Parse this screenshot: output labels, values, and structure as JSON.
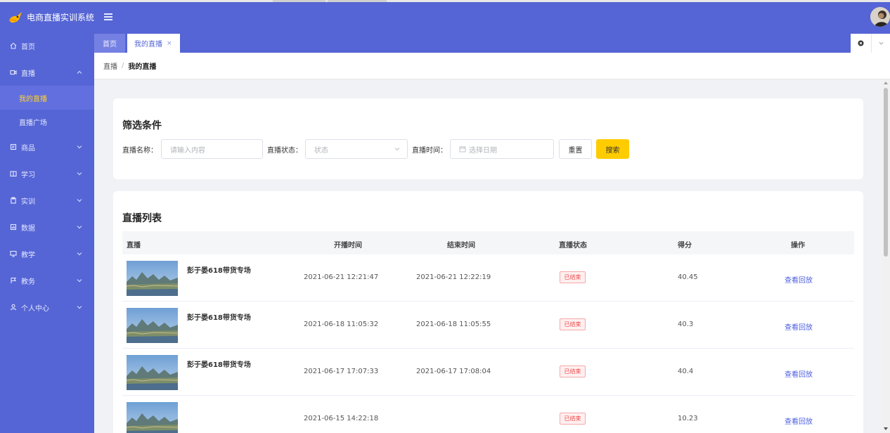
{
  "app": {
    "title": "电商直播实训系统"
  },
  "sidebar": {
    "items": [
      {
        "label": "首页",
        "icon": "home-icon",
        "has_children": false
      },
      {
        "label": "直播",
        "icon": "video-camera-icon",
        "has_children": true,
        "expanded": true,
        "children": [
          {
            "label": "我的直播",
            "active": true
          },
          {
            "label": "直播广场",
            "active": false
          }
        ]
      },
      {
        "label": "商品",
        "icon": "goods-icon",
        "has_children": true,
        "expanded": false
      },
      {
        "label": "学习",
        "icon": "book-icon",
        "has_children": true,
        "expanded": false
      },
      {
        "label": "实训",
        "icon": "clipboard-icon",
        "has_children": true,
        "expanded": false
      },
      {
        "label": "数据",
        "icon": "data-chart-icon",
        "has_children": true,
        "expanded": false
      },
      {
        "label": "教学",
        "icon": "monitor-icon",
        "has_children": true,
        "expanded": false
      },
      {
        "label": "教务",
        "icon": "flag-icon",
        "has_children": true,
        "expanded": false
      },
      {
        "label": "个人中心",
        "icon": "user-icon",
        "has_children": true,
        "expanded": false
      }
    ]
  },
  "tabs": {
    "home": "首页",
    "current": "我的直播",
    "close": "×"
  },
  "breadcrumb": {
    "parent": "直播",
    "separator": "/",
    "current": "我的直播"
  },
  "filter": {
    "title": "筛选条件",
    "name_label": "直播名称：",
    "name_placeholder": "请输入内容",
    "status_label": "直播状态：",
    "status_placeholder": "状态",
    "time_label": "直播时间：",
    "time_placeholder": "选择日期",
    "reset_label": "重置",
    "search_label": "搜索"
  },
  "list": {
    "title": "直播列表",
    "columns": {
      "live": "直播",
      "start": "开播时间",
      "end": "结束时间",
      "status": "直播状态",
      "score": "得分",
      "action": "操作"
    },
    "rows": [
      {
        "name": "彭于晏618带货专场",
        "start": "2021-06-21 12:21:47",
        "end": "2021-06-21 12:22:19",
        "status": "已结束",
        "score": "40.45",
        "action": "查看回放"
      },
      {
        "name": "彭于晏618带货专场",
        "start": "2021-06-18 11:05:32",
        "end": "2021-06-18 11:05:55",
        "status": "已结束",
        "score": "40.3",
        "action": "查看回放"
      },
      {
        "name": "彭于晏618带货专场",
        "start": "2021-06-17 17:07:33",
        "end": "2021-06-17 17:08:04",
        "status": "已结束",
        "score": "40.4",
        "action": "查看回放"
      },
      {
        "name": "",
        "start": "2021-06-15 14:22:18",
        "end": "",
        "status": "已结束",
        "score": "10.23",
        "action": "查看回放"
      }
    ]
  },
  "colors": {
    "brand": "#5565d5",
    "accent": "#ffcc00",
    "active_menu_text": "#ffd12b",
    "link": "#4c5ee0",
    "status_red": "#f04848"
  }
}
